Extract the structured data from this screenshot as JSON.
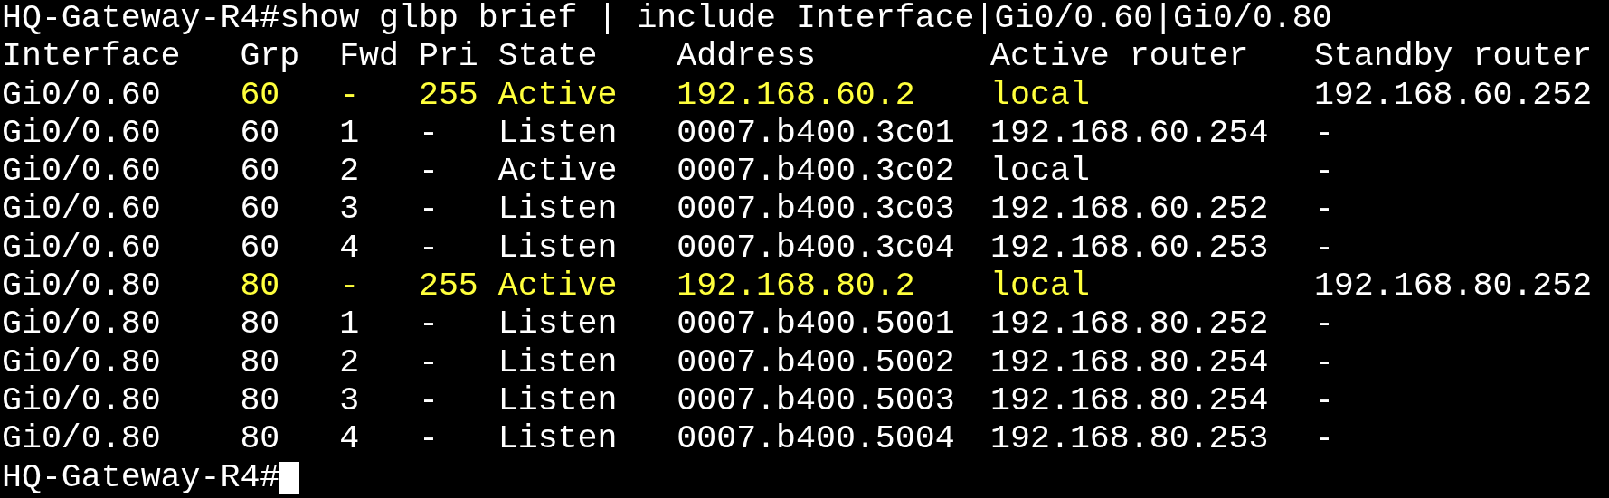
{
  "terminal": {
    "command_line": "HQ-Gateway-R4#show glbp brief | include Interface|Gi0/0.60|Gi0/0.80",
    "columns": [
      "Interface",
      "Grp",
      "Fwd",
      "Pri",
      "State",
      "Address",
      "Active router",
      "Standby router"
    ],
    "rows": [
      {
        "cells": [
          "Gi0/0.60",
          "60",
          "-",
          "255",
          "Active",
          "192.168.60.2",
          "local",
          "192.168.60.252"
        ],
        "highlighted": true
      },
      {
        "cells": [
          "Gi0/0.60",
          "60",
          "1",
          "-",
          "Listen",
          "0007.b400.3c01",
          "192.168.60.254",
          "-"
        ],
        "highlighted": false
      },
      {
        "cells": [
          "Gi0/0.60",
          "60",
          "2",
          "-",
          "Active",
          "0007.b400.3c02",
          "local",
          "-"
        ],
        "highlighted": false
      },
      {
        "cells": [
          "Gi0/0.60",
          "60",
          "3",
          "-",
          "Listen",
          "0007.b400.3c03",
          "192.168.60.252",
          "-"
        ],
        "highlighted": false
      },
      {
        "cells": [
          "Gi0/0.60",
          "60",
          "4",
          "-",
          "Listen",
          "0007.b400.3c04",
          "192.168.60.253",
          "-"
        ],
        "highlighted": false
      },
      {
        "cells": [
          "Gi0/0.80",
          "80",
          "-",
          "255",
          "Active",
          "192.168.80.2",
          "local",
          "192.168.80.252"
        ],
        "highlighted": true
      },
      {
        "cells": [
          "Gi0/0.80",
          "80",
          "1",
          "-",
          "Listen",
          "0007.b400.5001",
          "192.168.80.252",
          "-"
        ],
        "highlighted": false
      },
      {
        "cells": [
          "Gi0/0.80",
          "80",
          "2",
          "-",
          "Listen",
          "0007.b400.5002",
          "192.168.80.254",
          "-"
        ],
        "highlighted": false
      },
      {
        "cells": [
          "Gi0/0.80",
          "80",
          "3",
          "-",
          "Listen",
          "0007.b400.5003",
          "192.168.80.254",
          "-"
        ],
        "highlighted": false
      },
      {
        "cells": [
          "Gi0/0.80",
          "80",
          "4",
          "-",
          "Listen",
          "0007.b400.5004",
          "192.168.80.253",
          "-"
        ],
        "highlighted": false
      }
    ],
    "prompt": "HQ-Gateway-R4#",
    "cursor": true
  }
}
